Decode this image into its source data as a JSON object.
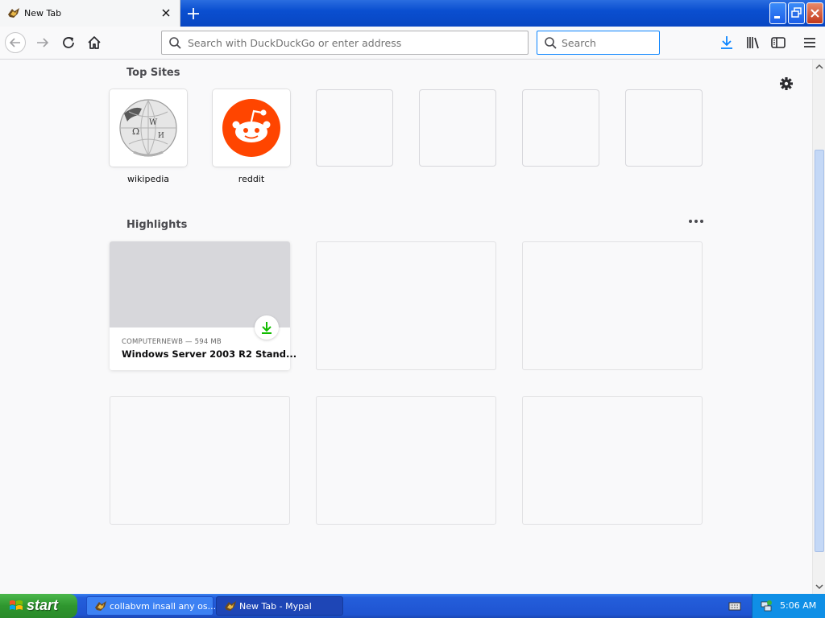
{
  "tab": {
    "title": "New Tab",
    "close_icon": "close-icon"
  },
  "toolbar": {
    "url_placeholder": "Search with DuckDuckGo or enter address",
    "search_placeholder": "Search"
  },
  "top_sites": {
    "heading": "Top Sites",
    "sites": [
      {
        "label": "wikipedia",
        "icon": "wikipedia-globe-icon"
      },
      {
        "label": "reddit",
        "icon": "reddit-alien-icon"
      },
      {
        "label": ""
      },
      {
        "label": ""
      },
      {
        "label": ""
      },
      {
        "label": ""
      }
    ]
  },
  "highlights": {
    "heading": "Highlights",
    "cards": [
      {
        "meta": "COMPUTERNEWB — 594 MB",
        "title": "Windows Server 2003 R2 Stand...",
        "badge_icon": "download-icon"
      }
    ]
  },
  "taskbar": {
    "start_label": "start",
    "tasks": [
      {
        "label": "collabvm insall any os..."
      },
      {
        "label": "New Tab - Mypal"
      }
    ],
    "clock": "5:06 AM"
  },
  "colors": {
    "accent": "#0a84ff",
    "reddit": "#ff4500",
    "download_green": "#12bc00",
    "xp_blue": "#245edb",
    "xp_start_green": "#3aa53a"
  }
}
